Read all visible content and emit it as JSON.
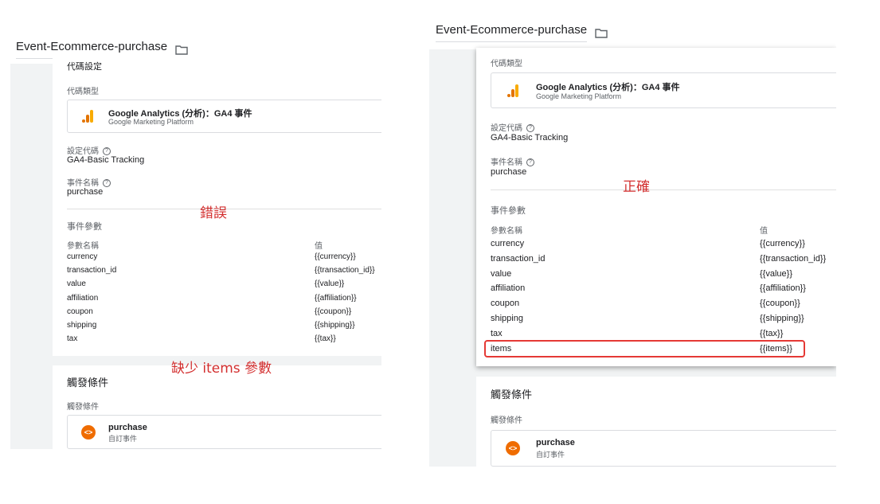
{
  "left": {
    "title": "Event-Ecommerce-purchase",
    "truncated_heading": "代碼設定",
    "tag_type_label": "代碼類型",
    "tag_name": "Google Analytics (分析)：GA4 事件",
    "tag_platform": "Google Marketing Platform",
    "config_tag_label": "設定代碼",
    "config_tag_value": "GA4-Basic Tracking",
    "event_name_label": "事件名稱",
    "event_name_value": "purchase",
    "event_params_label": "事件參數",
    "param_name_header": "參數名稱",
    "value_header": "值",
    "params": [
      {
        "name": "currency",
        "value": "{{currency}}"
      },
      {
        "name": "transaction_id",
        "value": "{{transaction_id}}"
      },
      {
        "name": "value",
        "value": "{{value}}"
      },
      {
        "name": "affiliation",
        "value": "{{affiliation}}"
      },
      {
        "name": "coupon",
        "value": "{{coupon}}"
      },
      {
        "name": "shipping",
        "value": "{{shipping}}"
      },
      {
        "name": "tax",
        "value": "{{tax}}"
      }
    ],
    "trigger_heading": "觸發條件",
    "trigger_label": "觸發條件",
    "trigger_name": "purchase",
    "trigger_type": "自訂事件"
  },
  "right": {
    "title": "Event-Ecommerce-purchase",
    "tag_type_label": "代碼類型",
    "tag_name": "Google Analytics (分析)：GA4 事件",
    "tag_platform": "Google Marketing Platform",
    "config_tag_label": "設定代碼",
    "config_tag_value": "GA4-Basic Tracking",
    "event_name_label": "事件名稱",
    "event_name_value": "purchase",
    "event_params_label": "事件參數",
    "param_name_header": "參數名稱",
    "value_header": "值",
    "params": [
      {
        "name": "currency",
        "value": "{{currency}}"
      },
      {
        "name": "transaction_id",
        "value": "{{transaction_id}}"
      },
      {
        "name": "value",
        "value": "{{value}}"
      },
      {
        "name": "affiliation",
        "value": "{{affiliation}}"
      },
      {
        "name": "coupon",
        "value": "{{coupon}}"
      },
      {
        "name": "shipping",
        "value": "{{shipping}}"
      },
      {
        "name": "tax",
        "value": "{{tax}}"
      },
      {
        "name": "items",
        "value": "{{items}}"
      }
    ],
    "trigger_heading": "觸發條件",
    "trigger_label": "觸發條件",
    "trigger_name": "purchase",
    "trigger_type": "自訂事件"
  },
  "annotations": {
    "wrong": "錯誤",
    "missing": "缺少 items 參數",
    "correct": "正確"
  },
  "icons": {
    "folder": "folder-icon",
    "help": "help-circle-icon",
    "ga": "google-analytics-icon",
    "trigger": "custom-event-icon"
  },
  "colors": {
    "annotation_red": "#d32f2f",
    "ga_orange": "#f9ab00",
    "ga_dark_orange": "#e37400",
    "trigger_orange": "#ef6c00",
    "panel_gray": "#f1f3f4"
  }
}
